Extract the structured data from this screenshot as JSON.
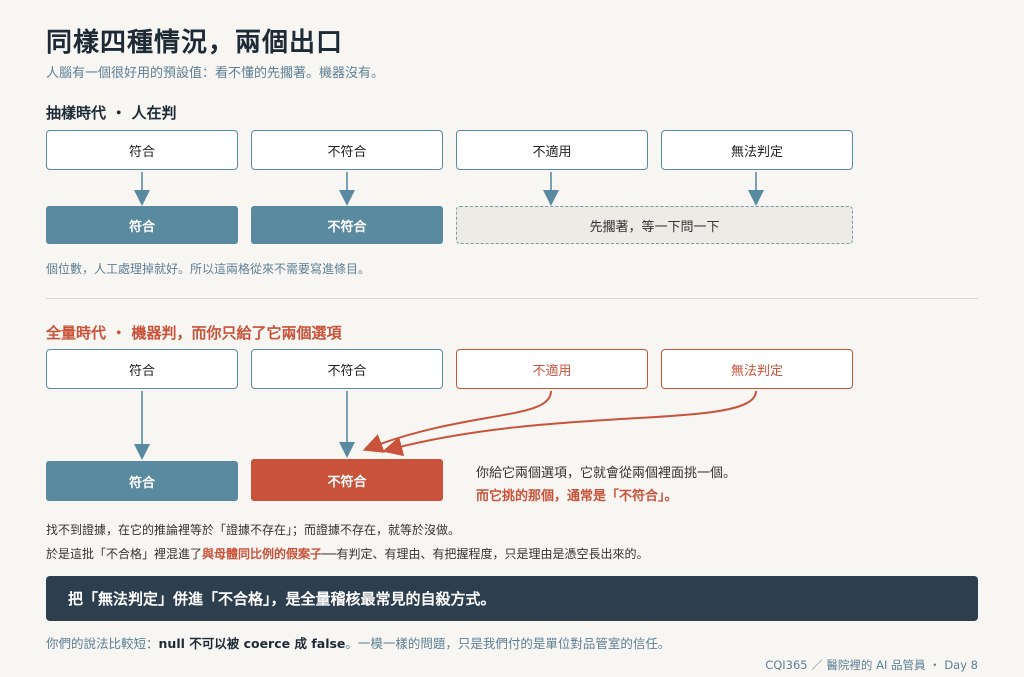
{
  "title": "同樣四種情況，兩個出口",
  "subtitle": "人腦有一個很好用的預設值：看不懂的先擱著。機器沒有。",
  "section1": {
    "heading": "抽樣時代 ・ 人在判",
    "inputs": [
      "符合",
      "不符合",
      "不適用",
      "無法判定"
    ],
    "outputs": [
      "符合",
      "不符合"
    ],
    "pending": "先擱著，等一下問一下",
    "note": "個位數，人工處理掉就好。所以這兩格從來不需要寫進條目。"
  },
  "section2": {
    "heading": "全量時代 ・ 機器判，而你只給了它兩個選項",
    "inputs": [
      "符合",
      "不符合",
      "不適用",
      "無法判定"
    ],
    "outputs": [
      "符合",
      "不符合"
    ],
    "aside_line1": "你給它兩個選項，它就會從兩個裡面挑一個。",
    "aside_line2": "而它挑的那個，通常是「不符合」。",
    "para1": "找不到證據，在它的推論裡等於「證據不存在」；而證據不存在，就等於沒做。",
    "para2_pre": "於是這批「不合格」裡混進了",
    "para2_highlight": "與母體同比例的假案子",
    "para2_post": "──有判定、有理由、有把握程度，只是理由是憑空長出來的。"
  },
  "banner": "把「無法判定」併進「不合格」，是全量稽核最常見的自殺方式。",
  "footer": {
    "pre": "你們的說法比較短：",
    "code": "null 不可以被 coerce 成 false",
    "post": "。一模一樣的問題，只是我們付的是單位對品管室的信任。"
  },
  "credit": "CQI365 ／ 醫院裡的 AI 品管員 ・ Day 8",
  "colors": {
    "blue": "#5a8aa0",
    "red": "#c9533a",
    "dark": "#2d3e4e",
    "background": "#f7f6f2"
  }
}
